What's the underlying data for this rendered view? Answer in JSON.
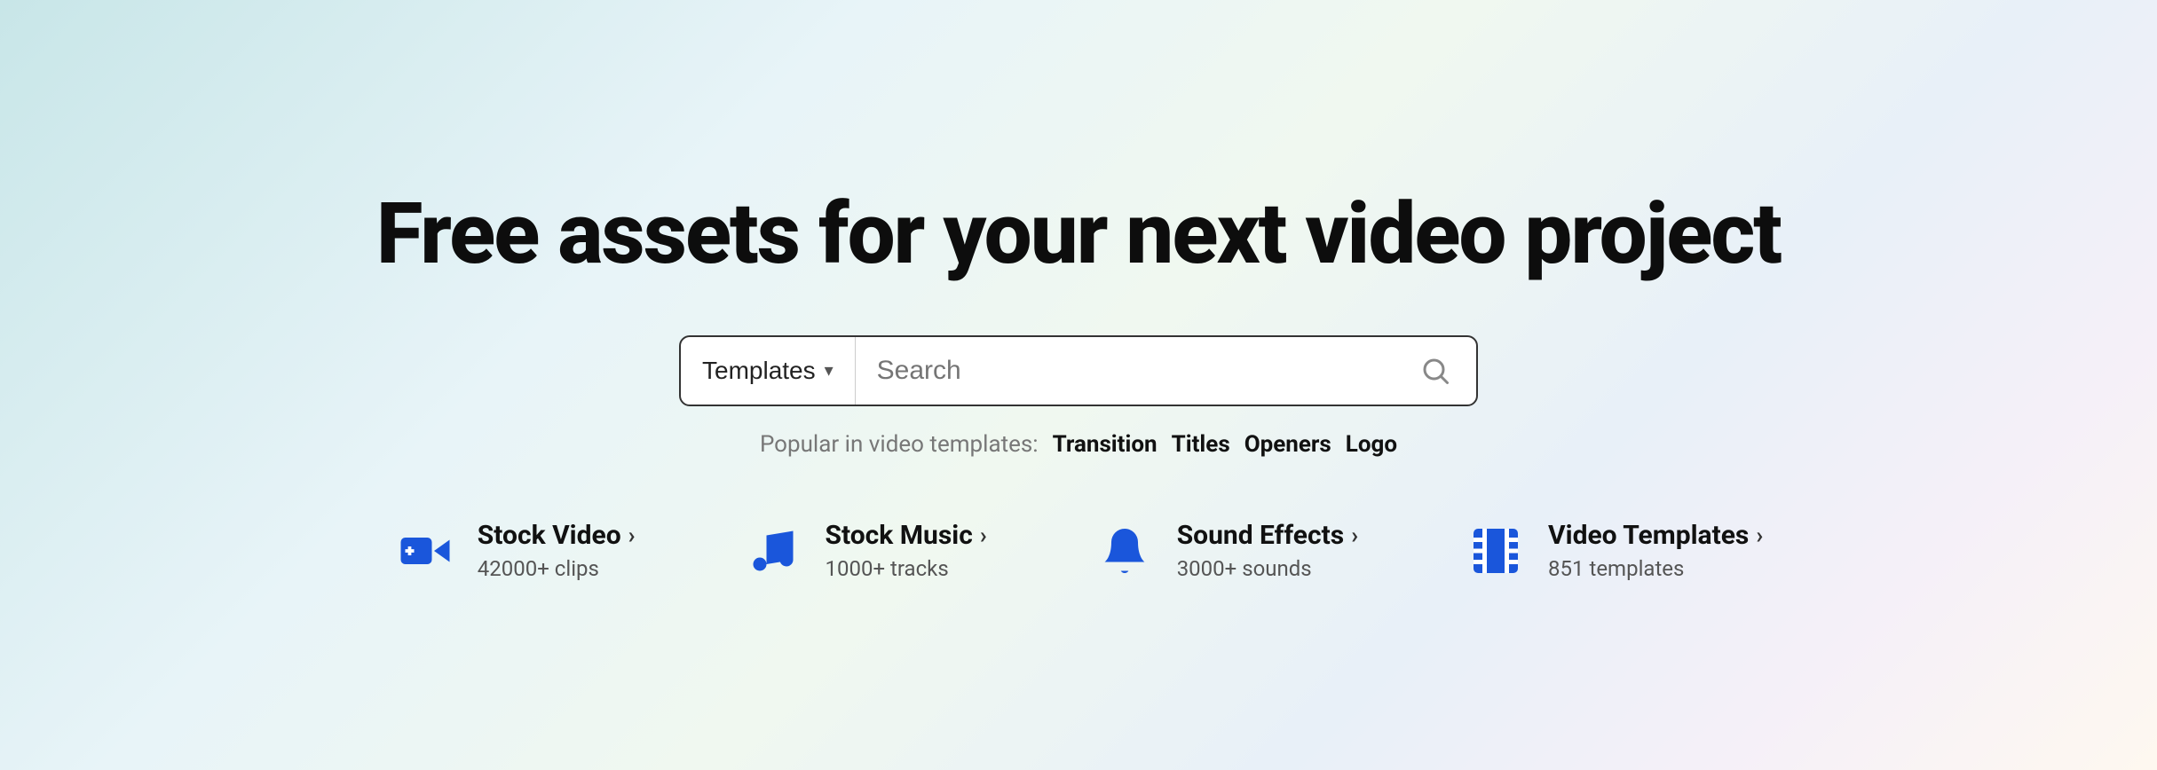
{
  "hero": {
    "title": "Free assets for your next video project"
  },
  "search": {
    "category_label": "Templates",
    "placeholder": "Search",
    "dropdown_arrow": "▾"
  },
  "popular": {
    "label": "Popular in video templates:",
    "tags": [
      "Transition",
      "Titles",
      "Openers",
      "Logo"
    ]
  },
  "categories": [
    {
      "id": "stock-video",
      "title": "Stock Video",
      "subtitle": "42000+ clips",
      "arrow": "›",
      "icon": "video-camera-icon"
    },
    {
      "id": "stock-music",
      "title": "Stock Music",
      "subtitle": "1000+ tracks",
      "arrow": "›",
      "icon": "music-note-icon"
    },
    {
      "id": "sound-effects",
      "title": "Sound Effects",
      "subtitle": "3000+ sounds",
      "arrow": "›",
      "icon": "bell-icon"
    },
    {
      "id": "video-templates",
      "title": "Video Templates",
      "subtitle": "851 templates",
      "arrow": "›",
      "icon": "film-strip-icon"
    }
  ]
}
